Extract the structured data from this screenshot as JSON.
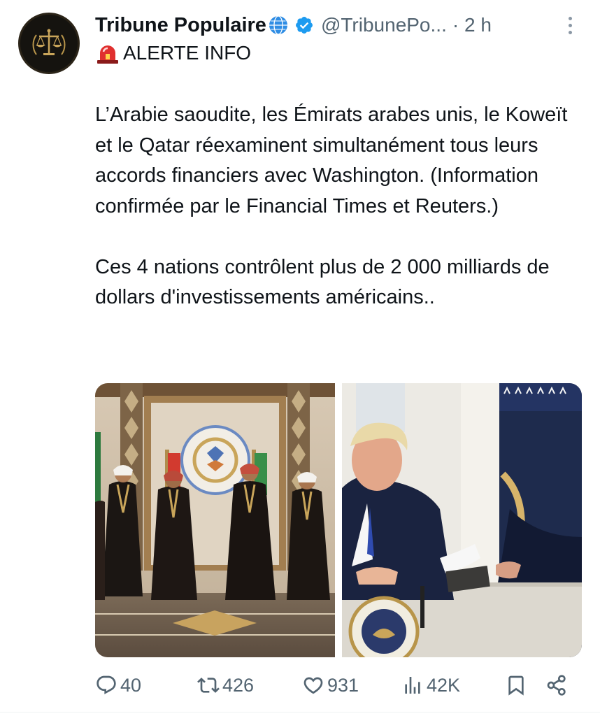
{
  "tweet": {
    "author_name": "Tribune Populaire",
    "handle": "@TribunePo...",
    "time": "· 2 h",
    "alert_line": "ALERTE INFO",
    "paragraphs": [
      "L’Arabie saoudite, les Émirats arabes unis, le Koweït et le Qatar réexaminent simultanément tous leurs accords financiers avec Washington. (Information confirmée par le Financial Times et Reuters.)",
      "Ces 4 nations contrôlent plus de 2 000 milliards de dollars d'investissements américains.."
    ],
    "media": [
      {
        "icon": "photo-gulf-leaders"
      },
      {
        "icon": "photo-president-signing"
      }
    ]
  },
  "actions": {
    "replies": "40",
    "reposts": "426",
    "likes": "931",
    "views": "42K"
  },
  "colors": {
    "text": "#0f1419",
    "secondary": "#536471",
    "verified": "#1d9bf0"
  }
}
